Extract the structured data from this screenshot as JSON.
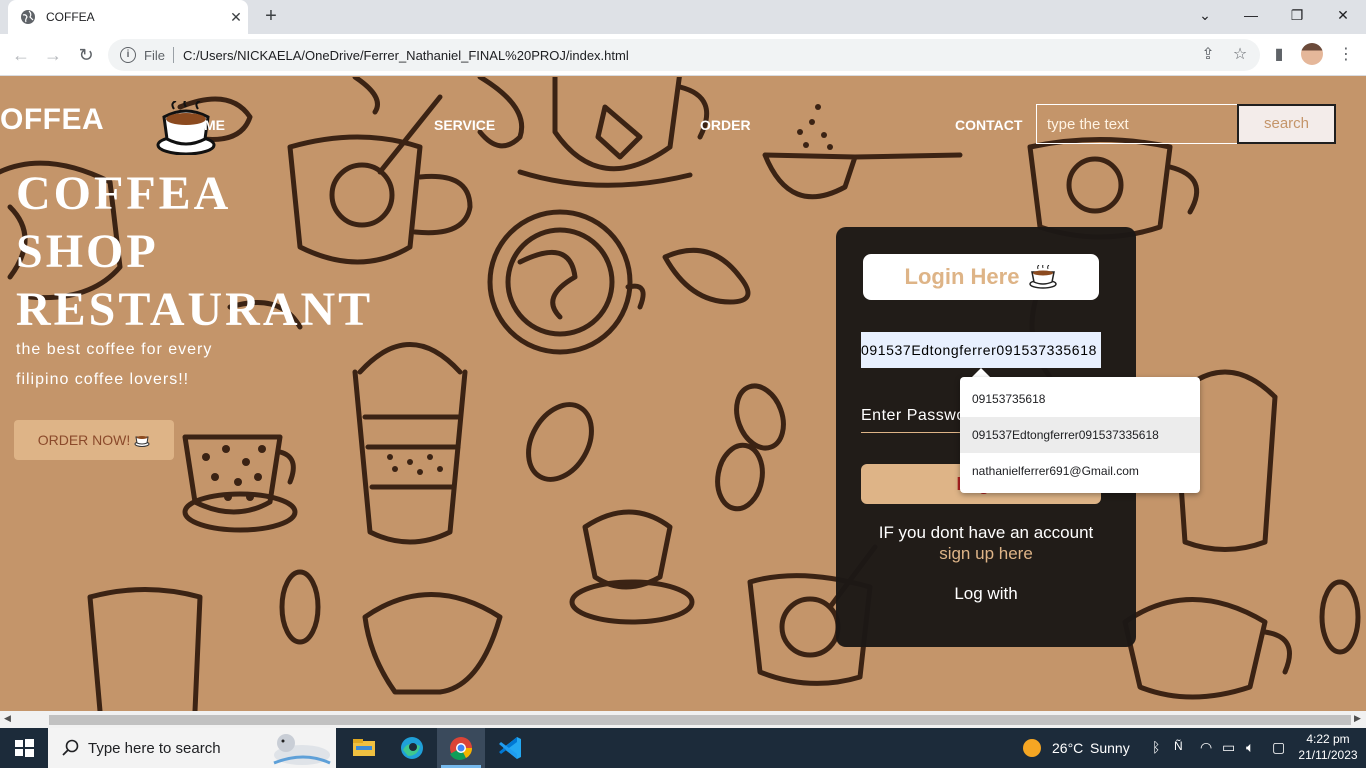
{
  "browser": {
    "tab_title": "COFFEA",
    "scheme_label": "File",
    "url": "C:/Users/NICKAELA/OneDrive/Ferrer_Nathaniel_FINAL%20PROJ/index.html"
  },
  "nav": {
    "brand": "OFFEA",
    "links": [
      "ME",
      "SERVICE",
      "ORDER",
      "CONTACT"
    ],
    "search_placeholder": "type the text",
    "search_button": "search"
  },
  "hero": {
    "title_lines": [
      "COFFEA",
      "SHOP",
      "RESTAURANT"
    ],
    "subtitle": "the best coffee for every filipino coffee lovers!!",
    "order_button": "ORDER NOW!"
  },
  "login": {
    "heading": "Login Here",
    "username_value": "091537Edtongferrer091537335618",
    "password_placeholder": "Enter Password",
    "button_label": "Login",
    "no_account_text": "IF you dont have an account",
    "signup_link": "sign up here",
    "log_with": "Log with"
  },
  "autofill": {
    "items": [
      "09153735618",
      "091537Edtongferrer091537335618",
      "nathanielferrer691@Gmail.com"
    ],
    "highlighted_index": 1
  },
  "taskbar": {
    "search_placeholder": "Type here to search",
    "weather": "26°C",
    "weather_condition": "Sunny",
    "time": "4:22 pm",
    "date": "21/11/2023"
  },
  "colors": {
    "page_bg": "#c4956a",
    "accent_tan": "#deb487",
    "card_bg": "#1c1816",
    "doodle_stroke": "#3b2314"
  }
}
